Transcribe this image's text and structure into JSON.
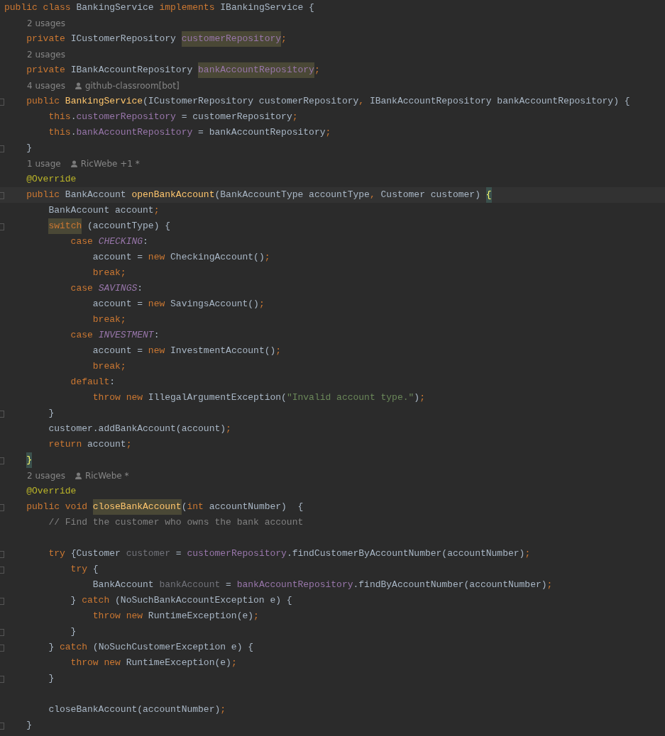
{
  "editor": {
    "lines": [
      {
        "kind": "code",
        "tokens": [
          {
            "kind": "kw",
            "text": "public class "
          },
          {
            "kind": "txt",
            "text": "BankingService "
          },
          {
            "kind": "kw",
            "text": "implements "
          },
          {
            "kind": "txt",
            "text": "IBankingService {"
          }
        ]
      },
      {
        "kind": "hint",
        "tokens": [
          {
            "kind": "usages",
            "text": "2 usages"
          }
        ]
      },
      {
        "kind": "code",
        "tokens": [
          {
            "kind": "kw",
            "text": "    private "
          },
          {
            "kind": "txt",
            "text": "ICustomerRepository "
          },
          {
            "kind": "fld",
            "text": "customerRepository",
            "highlight": true
          },
          {
            "kind": "kw",
            "text": ";"
          }
        ]
      },
      {
        "kind": "hint",
        "tokens": [
          {
            "kind": "usages",
            "text": "2 usages"
          }
        ]
      },
      {
        "kind": "code",
        "tokens": [
          {
            "kind": "kw",
            "text": "    private "
          },
          {
            "kind": "txt",
            "text": "IBankAccountRepository "
          },
          {
            "kind": "fld",
            "text": "bankAccountRepository",
            "highlight": true
          },
          {
            "kind": "kw",
            "text": ";"
          }
        ]
      },
      {
        "kind": "hint",
        "tokens": [
          {
            "kind": "usages",
            "text": "4 usages"
          },
          {
            "kind": "author",
            "text": "github-classroom[bot]"
          }
        ]
      },
      {
        "kind": "code",
        "fold": true,
        "tokens": [
          {
            "kind": "kw",
            "text": "    public "
          },
          {
            "kind": "fn",
            "text": "BankingService"
          },
          {
            "kind": "txt",
            "text": "(ICustomerRepository customerRepository"
          },
          {
            "kind": "kw",
            "text": ", "
          },
          {
            "kind": "txt",
            "text": "IBankAccountRepository bankAccountRepository) {"
          }
        ]
      },
      {
        "kind": "code",
        "tokens": [
          {
            "kind": "kw",
            "text": "        this"
          },
          {
            "kind": "txt",
            "text": "."
          },
          {
            "kind": "fld",
            "text": "customerRepository"
          },
          {
            "kind": "txt",
            "text": " = customerRepository"
          },
          {
            "kind": "kw",
            "text": ";"
          }
        ]
      },
      {
        "kind": "code",
        "tokens": [
          {
            "kind": "kw",
            "text": "        this"
          },
          {
            "kind": "txt",
            "text": "."
          },
          {
            "kind": "fld",
            "text": "bankAccountRepository"
          },
          {
            "kind": "txt",
            "text": " = bankAccountRepository"
          },
          {
            "kind": "kw",
            "text": ";"
          }
        ]
      },
      {
        "kind": "code",
        "fold": true,
        "tokens": [
          {
            "kind": "txt",
            "text": "    }"
          }
        ]
      },
      {
        "kind": "hint",
        "tokens": [
          {
            "kind": "usages",
            "text": "1 usage"
          },
          {
            "kind": "author",
            "text": "RicWebe +1 *"
          }
        ]
      },
      {
        "kind": "code",
        "tokens": [
          {
            "kind": "ann",
            "text": "    @Override"
          }
        ]
      },
      {
        "kind": "code",
        "fold": true,
        "current": true,
        "tokens": [
          {
            "kind": "kw",
            "text": "    public "
          },
          {
            "kind": "txt",
            "text": "BankAccount "
          },
          {
            "kind": "fn",
            "text": "openBankAccount"
          },
          {
            "kind": "txt",
            "text": "(BankAccountType accountType"
          },
          {
            "kind": "kw",
            "text": ", "
          },
          {
            "kind": "txt",
            "text": "Customer customer) "
          },
          {
            "kind": "brace",
            "text": "{",
            "matched": true
          }
        ]
      },
      {
        "kind": "code",
        "tokens": [
          {
            "kind": "txt",
            "text": "        BankAccount account"
          },
          {
            "kind": "kw",
            "text": ";"
          }
        ]
      },
      {
        "kind": "code",
        "fold": true,
        "tokens": [
          {
            "kind": "kw",
            "text": "        switch",
            "highlight": true
          },
          {
            "kind": "txt",
            "text": " (accountType) {"
          }
        ]
      },
      {
        "kind": "code",
        "tokens": [
          {
            "kind": "kw",
            "text": "            case "
          },
          {
            "kind": "const",
            "text": "CHECKING"
          },
          {
            "kind": "txt",
            "text": ":"
          }
        ]
      },
      {
        "kind": "code",
        "tokens": [
          {
            "kind": "txt",
            "text": "                account = "
          },
          {
            "kind": "kw",
            "text": "new "
          },
          {
            "kind": "txt",
            "text": "CheckingAccount()"
          },
          {
            "kind": "kw",
            "text": ";"
          }
        ]
      },
      {
        "kind": "code",
        "tokens": [
          {
            "kind": "kw",
            "text": "                break;"
          }
        ]
      },
      {
        "kind": "code",
        "tokens": [
          {
            "kind": "kw",
            "text": "            case "
          },
          {
            "kind": "const",
            "text": "SAVINGS"
          },
          {
            "kind": "txt",
            "text": ":"
          }
        ]
      },
      {
        "kind": "code",
        "tokens": [
          {
            "kind": "txt",
            "text": "                account = "
          },
          {
            "kind": "kw",
            "text": "new "
          },
          {
            "kind": "txt",
            "text": "SavingsAccount()"
          },
          {
            "kind": "kw",
            "text": ";"
          }
        ]
      },
      {
        "kind": "code",
        "tokens": [
          {
            "kind": "kw",
            "text": "                break;"
          }
        ]
      },
      {
        "kind": "code",
        "tokens": [
          {
            "kind": "kw",
            "text": "            case "
          },
          {
            "kind": "const",
            "text": "INVESTMENT"
          },
          {
            "kind": "txt",
            "text": ":"
          }
        ]
      },
      {
        "kind": "code",
        "tokens": [
          {
            "kind": "txt",
            "text": "                account = "
          },
          {
            "kind": "kw",
            "text": "new "
          },
          {
            "kind": "txt",
            "text": "InvestmentAccount()"
          },
          {
            "kind": "kw",
            "text": ";"
          }
        ]
      },
      {
        "kind": "code",
        "tokens": [
          {
            "kind": "kw",
            "text": "                break;"
          }
        ]
      },
      {
        "kind": "code",
        "tokens": [
          {
            "kind": "kw",
            "text": "            default"
          },
          {
            "kind": "txt",
            "text": ":"
          }
        ]
      },
      {
        "kind": "code",
        "tokens": [
          {
            "kind": "kw",
            "text": "                throw new "
          },
          {
            "kind": "txt",
            "text": "IllegalArgumentException("
          },
          {
            "kind": "str",
            "text": "\"Invalid account type.\""
          },
          {
            "kind": "txt",
            "text": ")"
          },
          {
            "kind": "kw",
            "text": ";"
          }
        ]
      },
      {
        "kind": "code",
        "fold": true,
        "tokens": [
          {
            "kind": "txt",
            "text": "        }"
          }
        ]
      },
      {
        "kind": "code",
        "tokens": [
          {
            "kind": "txt",
            "text": "        customer.addBankAccount(account)"
          },
          {
            "kind": "kw",
            "text": ";"
          }
        ]
      },
      {
        "kind": "code",
        "tokens": [
          {
            "kind": "kw",
            "text": "        return "
          },
          {
            "kind": "txt",
            "text": "account"
          },
          {
            "kind": "kw",
            "text": ";"
          }
        ]
      },
      {
        "kind": "code",
        "fold": true,
        "tokens": [
          {
            "kind": "brace",
            "text": "    }",
            "matched": true
          }
        ]
      },
      {
        "kind": "hint",
        "tokens": [
          {
            "kind": "usages",
            "text": "2 usages"
          },
          {
            "kind": "author",
            "text": "RicWebe *"
          }
        ]
      },
      {
        "kind": "code",
        "tokens": [
          {
            "kind": "ann",
            "text": "    @Override"
          }
        ]
      },
      {
        "kind": "code",
        "fold": true,
        "tokens": [
          {
            "kind": "kw",
            "text": "    public void "
          },
          {
            "kind": "fn",
            "text": "closeBankAccount",
            "highlight": true
          },
          {
            "kind": "txt",
            "text": "("
          },
          {
            "kind": "kw",
            "text": "int "
          },
          {
            "kind": "txt",
            "text": "accountNumber)  {"
          }
        ]
      },
      {
        "kind": "code",
        "tokens": [
          {
            "kind": "cmt",
            "text": "        // Find the customer who owns the bank account"
          }
        ]
      },
      {
        "kind": "blank"
      },
      {
        "kind": "code",
        "fold": true,
        "tokens": [
          {
            "kind": "kw",
            "text": "        try "
          },
          {
            "kind": "txt",
            "text": "{Customer "
          },
          {
            "kind": "dim",
            "text": "customer"
          },
          {
            "kind": "txt",
            "text": " = "
          },
          {
            "kind": "fld",
            "text": "customerRepository"
          },
          {
            "kind": "txt",
            "text": ".findCustomerByAccountNumber(accountNumber)"
          },
          {
            "kind": "kw",
            "text": ";"
          }
        ]
      },
      {
        "kind": "code",
        "fold": true,
        "tokens": [
          {
            "kind": "kw",
            "text": "            try "
          },
          {
            "kind": "txt",
            "text": "{"
          }
        ]
      },
      {
        "kind": "code",
        "tokens": [
          {
            "kind": "txt",
            "text": "                BankAccount "
          },
          {
            "kind": "dim",
            "text": "bankAccount"
          },
          {
            "kind": "txt",
            "text": " = "
          },
          {
            "kind": "fld",
            "text": "bankAccountRepository"
          },
          {
            "kind": "txt",
            "text": ".findByAccountNumber(accountNumber)"
          },
          {
            "kind": "kw",
            "text": ";"
          }
        ]
      },
      {
        "kind": "code",
        "fold": true,
        "tokens": [
          {
            "kind": "txt",
            "text": "            } "
          },
          {
            "kind": "kw",
            "text": "catch "
          },
          {
            "kind": "txt",
            "text": "(NoSuchBankAccountException e) {"
          }
        ]
      },
      {
        "kind": "code",
        "tokens": [
          {
            "kind": "kw",
            "text": "                throw new "
          },
          {
            "kind": "txt",
            "text": "RuntimeException(e)"
          },
          {
            "kind": "kw",
            "text": ";"
          }
        ]
      },
      {
        "kind": "code",
        "fold": true,
        "tokens": [
          {
            "kind": "txt",
            "text": "            }"
          }
        ]
      },
      {
        "kind": "code",
        "fold": true,
        "tokens": [
          {
            "kind": "txt",
            "text": "        } "
          },
          {
            "kind": "kw",
            "text": "catch "
          },
          {
            "kind": "txt",
            "text": "(NoSuchCustomerException e) {"
          }
        ]
      },
      {
        "kind": "code",
        "tokens": [
          {
            "kind": "kw",
            "text": "            throw new "
          },
          {
            "kind": "txt",
            "text": "RuntimeException(e)"
          },
          {
            "kind": "kw",
            "text": ";"
          }
        ]
      },
      {
        "kind": "code",
        "fold": true,
        "tokens": [
          {
            "kind": "txt",
            "text": "        }"
          }
        ]
      },
      {
        "kind": "blank"
      },
      {
        "kind": "code",
        "tokens": [
          {
            "kind": "txt",
            "text": "        closeBankAccount(accountNumber)"
          },
          {
            "kind": "kw",
            "text": ";"
          }
        ]
      },
      {
        "kind": "code",
        "fold": true,
        "tokens": [
          {
            "kind": "txt",
            "text": "    }"
          }
        ]
      }
    ]
  }
}
